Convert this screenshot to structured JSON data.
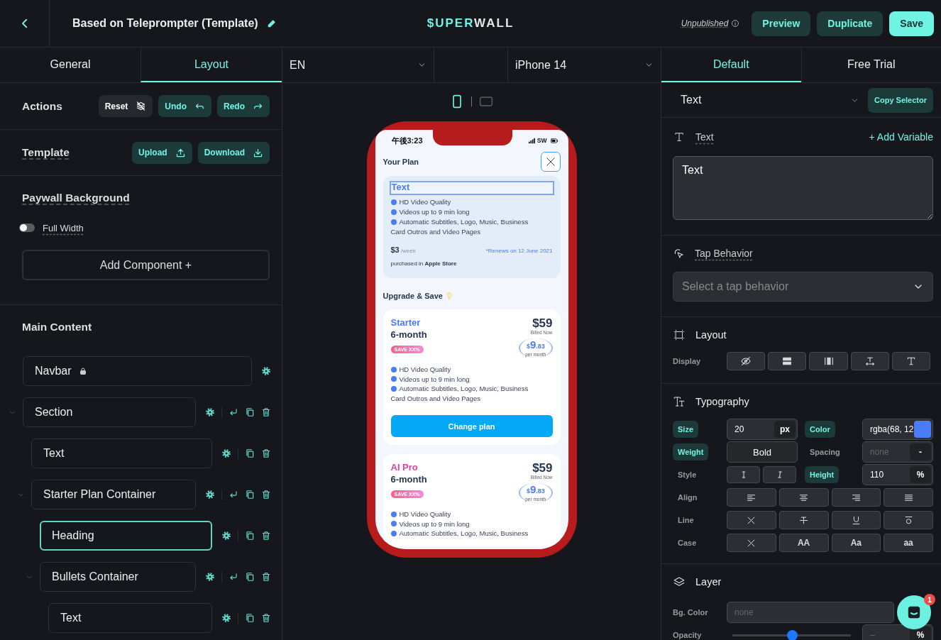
{
  "topbar": {
    "title": "Based on Teleprompter (Template)",
    "logo": {
      "accent": "$UPER",
      "rest": "WALL"
    },
    "status": "Unpublished",
    "buttons": [
      {
        "label": "Preview",
        "kind": "secondary"
      },
      {
        "label": "Duplicate",
        "kind": "secondary"
      },
      {
        "label": "Save",
        "kind": "primary"
      }
    ]
  },
  "left_tabs": [
    {
      "label": "General",
      "selected": false
    },
    {
      "label": "Layout",
      "selected": true
    }
  ],
  "preview_selects": {
    "language": "EN",
    "device": "iPhone 14"
  },
  "right_tabs": [
    {
      "label": "Default",
      "selected": true
    },
    {
      "label": "Free Trial",
      "selected": false
    }
  ],
  "actions": {
    "title": "Actions",
    "buttons": [
      {
        "label": "Reset",
        "kind": "neutral"
      },
      {
        "label": "Undo",
        "kind": "accent"
      },
      {
        "label": "Redo",
        "kind": "accent"
      }
    ]
  },
  "template": {
    "title": "Template",
    "buttons": [
      {
        "label": "Upload",
        "kind": "accent"
      },
      {
        "label": "Download",
        "kind": "accent"
      }
    ]
  },
  "background": {
    "title": "Paywall Background",
    "full_width": {
      "label": "Full Width",
      "on": false
    },
    "add_button": "Add Component +"
  },
  "main_content": {
    "title": "Main Content",
    "tree": [
      {
        "label": "Navbar",
        "locked": true,
        "selected": false
      },
      {
        "label": "Section",
        "locked": false,
        "selected": false,
        "expanded": true,
        "children": [
          {
            "label": "Text",
            "locked": false,
            "selected": false
          },
          {
            "label": "Starter Plan Container",
            "locked": false,
            "selected": false,
            "expanded": true,
            "children": [
              {
                "label": "Heading",
                "locked": false,
                "selected": true
              },
              {
                "label": "Bullets Container",
                "locked": false,
                "selected": false,
                "expanded": true,
                "children": [
                  {
                    "label": "Text",
                    "locked": false,
                    "selected": false
                  }
                ]
              }
            ]
          }
        ]
      }
    ]
  },
  "device_modes": [
    {
      "kind": "portrait",
      "selected": true
    },
    {
      "kind": "landscape",
      "selected": false
    }
  ],
  "phone": {
    "time": "午後3:23",
    "carrier": "SW",
    "title": "Your Plan",
    "current_plan": {
      "heading": {
        "text": "Text",
        "selected": true
      },
      "features": [
        "HD Video Quality",
        "Videos up to 9 min long",
        "Automatic Subtitles, Logo, Music, Business Card Outros and Video Pages"
      ],
      "price": "$3",
      "period": "/week",
      "renews": "*Renews on 12 June 2021",
      "purchased": "purchased in **Apple Store**"
    },
    "upgrade_title": "Upgrade & Save",
    "plans": [
      {
        "name": "Starter",
        "color": "#4a7cf7",
        "term": "6-month",
        "badge": "SAVE XX%",
        "price": "$59",
        "billed": "Billed Now",
        "monthly": {
          "currency": "$",
          "whole": "9",
          "cents": ".83",
          "label": "per month"
        },
        "features": [
          "HD Video Quality",
          "Videos up to 9 min long",
          "Automatic Subtitles, Logo, Music, Business Card Outros and Video Pages"
        ],
        "button": "Change plan"
      },
      {
        "name": "AI Pro",
        "color": "#e0409e",
        "term": "6-month",
        "badge": "SAVE XX%",
        "price": "$59",
        "billed": "Billed Now",
        "monthly": {
          "currency": "$",
          "whole": "9",
          "cents": ".83",
          "label": "per month"
        },
        "features": [
          "HD Video Quality",
          "Videos up to 9 min long",
          "Automatic Subtitles, Logo, Music, Business"
        ]
      }
    ]
  },
  "inspector": {
    "element": "Text",
    "copy_button": "Copy Selector",
    "text_section": {
      "title": "Text",
      "link": "+ Add Variable",
      "value": "Text"
    },
    "tap": {
      "title": "Tap Behavior",
      "placeholder": "Select a tap behavior"
    },
    "layout": {
      "title": "Layout",
      "display_label": "Display"
    },
    "typography": {
      "title": "Typography",
      "size": {
        "label": "Size",
        "set": true,
        "value": "20",
        "unit": "px"
      },
      "color": {
        "label": "Color",
        "set": true,
        "value": "rgba(68, 12",
        "color": "#4a7cf7"
      },
      "weight": {
        "label": "Weight",
        "set": true,
        "value": "Bold"
      },
      "spacing": {
        "label": "Spacing",
        "set": false,
        "placeholder": "none",
        "unit": "-"
      },
      "style": {
        "label": "Style",
        "set": false
      },
      "height": {
        "label": "Height",
        "set": true,
        "value": "110",
        "unit": "%"
      },
      "align": {
        "label": "Align",
        "set": false
      },
      "line": {
        "label": "Line",
        "set": false
      },
      "case": {
        "label": "Case",
        "set": false,
        "options": [
          "AA",
          "Aa",
          "aa"
        ]
      }
    },
    "layer": {
      "title": "Layer",
      "bg_label": "Bg. Color",
      "bg_placeholder": "none",
      "opacity_label": "Opacity",
      "opacity": {
        "level": 0.5
      },
      "opacity_placeholder": "–",
      "opacity_unit": "%"
    }
  },
  "chat": {
    "badge": "1"
  }
}
